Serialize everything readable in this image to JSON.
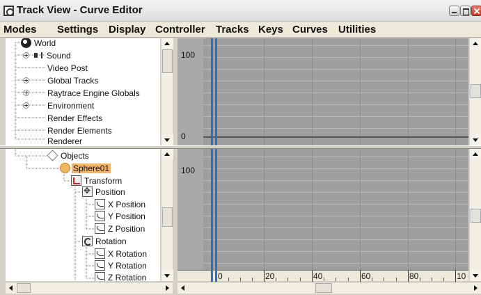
{
  "window": {
    "title": "Track View - Curve Editor"
  },
  "menu": [
    "Modes",
    "Settings",
    "Display",
    "Controller",
    "Tracks",
    "Keys",
    "Curves",
    "Utilities"
  ],
  "tree_top": {
    "items": [
      {
        "label": "World",
        "icon": "world-icon"
      },
      {
        "label": "Sound",
        "icon": "sound-icon"
      },
      {
        "label": "Video Post",
        "icon": ""
      },
      {
        "label": "Global Tracks",
        "icon": ""
      },
      {
        "label": "Raytrace Engine Globals",
        "icon": ""
      },
      {
        "label": "Environment",
        "icon": ""
      },
      {
        "label": "Render Effects",
        "icon": ""
      },
      {
        "label": "Render Elements",
        "icon": ""
      },
      {
        "label": "Renderer",
        "icon": ""
      }
    ]
  },
  "tree_bottom": {
    "items": [
      {
        "label": "Objects",
        "icon": "objects-icon"
      },
      {
        "label": "Sphere01",
        "icon": "sphere-icon",
        "selected": true
      },
      {
        "label": "Transform",
        "icon": "transform-icon"
      },
      {
        "label": "Position",
        "icon": "position-icon"
      },
      {
        "label": "X Position",
        "icon": "curve-icon"
      },
      {
        "label": "Y Position",
        "icon": "curve-icon"
      },
      {
        "label": "Z Position",
        "icon": "curve-icon"
      },
      {
        "label": "Rotation",
        "icon": "rotation-icon"
      },
      {
        "label": "X Rotation",
        "icon": "curve-icon"
      },
      {
        "label": "Y Rotation",
        "icon": "curve-icon"
      },
      {
        "label": "Z Rotation",
        "icon": "curve-icon"
      }
    ]
  },
  "curve_top": {
    "value_max": "100",
    "value_min": "0"
  },
  "curve_bottom": {
    "value_max": "100"
  },
  "ruler": {
    "labels": [
      "0",
      "20",
      "40",
      "60",
      "80",
      "10"
    ]
  },
  "colors": {
    "time_slider": "#2b6ec2",
    "selection": "#f2b46a",
    "graph_bg": "#9f9f9f"
  }
}
